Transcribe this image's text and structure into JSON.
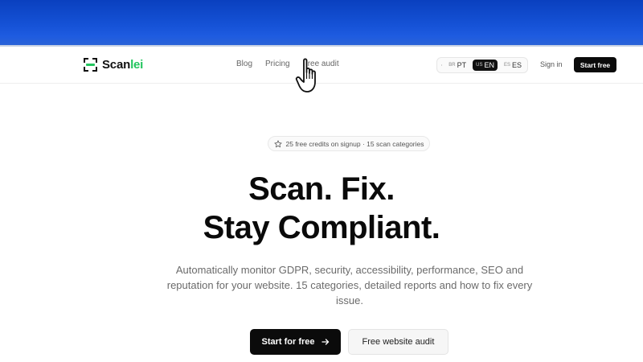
{
  "brand": {
    "name_main": "Scan",
    "name_accent": "lei",
    "accent_color": "#22c55e"
  },
  "nav": {
    "links": [
      "Blog",
      "Pricing",
      "Free audit"
    ],
    "languages": [
      {
        "code": "BR",
        "label": "PT",
        "active": false
      },
      {
        "code": "US",
        "label": "EN",
        "active": true
      },
      {
        "code": "ES",
        "label": "ES",
        "active": false
      }
    ],
    "sign_in": "Sign in",
    "start_free": "Start free"
  },
  "hero": {
    "badge": "25 free credits on signup · 15 scan categories",
    "headline_line1": "Scan. Fix.",
    "headline_line2": "Stay Compliant.",
    "subtitle": "Automatically monitor GDPR, security, accessibility, performance, SEO and reputation for your website. 15 categories, detailed reports and how to fix every issue.",
    "cta_primary": "Start for free",
    "cta_secondary": "Free website audit"
  },
  "icons": [
    "scan-logo-icon",
    "globe-icon",
    "star-icon",
    "arrow-right-icon",
    "hand-pointer-icon"
  ],
  "colors": {
    "top_band": "#1552d6",
    "primary_button": "#0b0b0b"
  }
}
